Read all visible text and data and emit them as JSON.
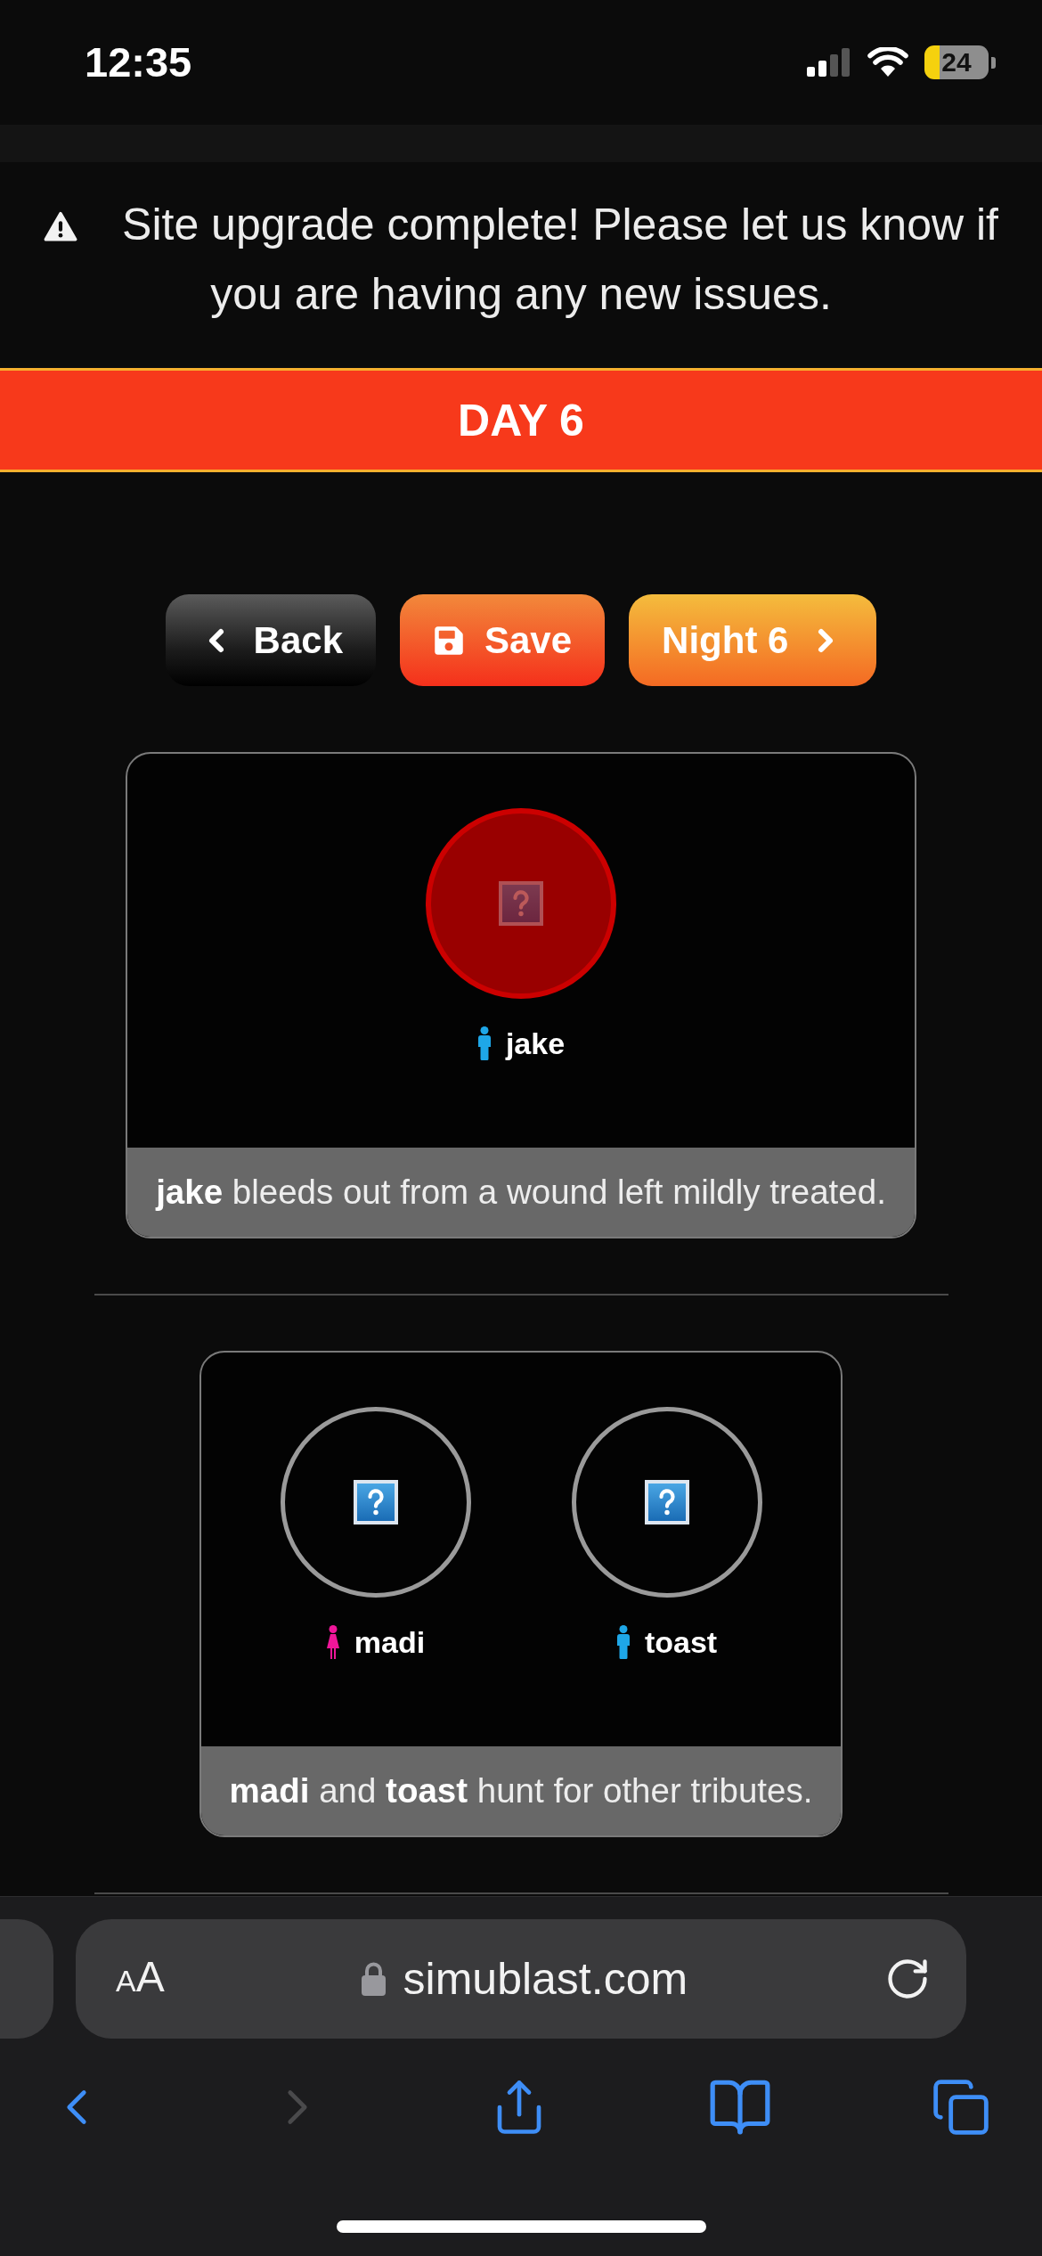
{
  "status_bar": {
    "time": "12:35",
    "battery": "24"
  },
  "alert": {
    "text": "Site upgrade complete! Please let us know if you are having any new issues."
  },
  "day_banner": {
    "title": "DAY 6"
  },
  "nav_buttons": [
    {
      "kind": "back",
      "label": "Back"
    },
    {
      "kind": "save",
      "label": "Save"
    },
    {
      "kind": "next",
      "label": "Night 6"
    }
  ],
  "events": [
    {
      "tributes": [
        {
          "name": "jake",
          "kind": "male",
          "color": "#1ea7e8",
          "dead": true
        }
      ],
      "caption": "**jake** bleeds out from a wound left mildly treated."
    },
    {
      "tributes": [
        {
          "name": "madi",
          "kind": "female",
          "color": "#f0169a",
          "dead": false
        },
        {
          "name": "toast",
          "kind": "male",
          "color": "#1ea7e8",
          "dead": false
        }
      ],
      "caption": "**madi** and **toast** hunt for other tributes."
    }
  ],
  "browser": {
    "text_size_button": "AA",
    "url": "simublast.com",
    "toolbar": [
      {
        "kind": "back",
        "disabled": false
      },
      {
        "kind": "forward",
        "disabled": true
      },
      {
        "kind": "share",
        "disabled": false
      },
      {
        "kind": "bookmarks",
        "disabled": false
      },
      {
        "kind": "tabs",
        "disabled": false
      }
    ]
  }
}
